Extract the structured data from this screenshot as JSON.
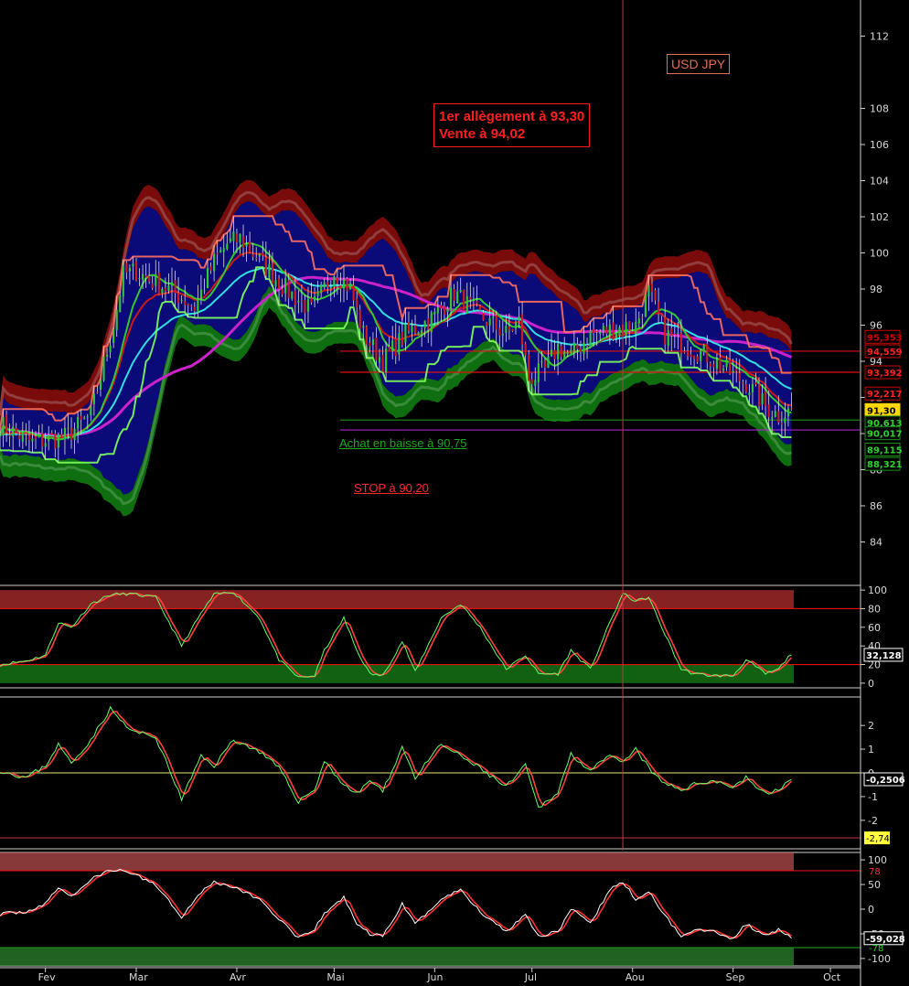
{
  "symbol_label": "USD JPY",
  "trade_note": {
    "line1": "1er allègement à 93,30",
    "line2": "Vente à 94,02"
  },
  "buy_note": "Achat en baisse à 90,75",
  "stop_note": "STOP à 90,20",
  "colors": {
    "background": "#000000",
    "band_fill": "#0a0a78",
    "upper_band": "#7a0b0b",
    "lower_band": "#0f6e0f",
    "cyan_ma": "#33dede",
    "magenta_ma": "#cc22cc",
    "red_ma": "#d01818",
    "green_ma": "#33c833",
    "salmon_stop": "#ff7060",
    "lime_stop": "#80ff60",
    "candle_up": "#33c833",
    "candle_down": "#cc1f1f"
  },
  "chart_data": [
    {
      "type": "candlestick",
      "title": "USD JPY",
      "x_tick_labels": [
        "Fev",
        "Mar",
        "Avr",
        "Mai",
        "Jun",
        "Jul",
        "Aou",
        "Sep",
        "Oct"
      ],
      "x_tick_days": [
        14,
        42,
        73,
        103,
        134,
        164,
        195,
        226,
        256
      ],
      "x_range_days": [
        0,
        265
      ],
      "ylim": [
        82,
        114
      ],
      "y_ticks": [
        84,
        86,
        88,
        90,
        92,
        94,
        96,
        98,
        100,
        102,
        104,
        106,
        108,
        112
      ],
      "price_keyframes": {
        "x": [
          0,
          10,
          20,
          28,
          35,
          38,
          42,
          46,
          52,
          60,
          66,
          70,
          74,
          80,
          88,
          96,
          103,
          108,
          112,
          118,
          125,
          134,
          140,
          148,
          156,
          160,
          163,
          168,
          172,
          176,
          182,
          190,
          196,
          200,
          205,
          212,
          218,
          224,
          230,
          236,
          240,
          244
        ],
        "y": [
          90.5,
          89.5,
          89.8,
          91.0,
          96.0,
          98.8,
          99.0,
          98.5,
          98.0,
          97.0,
          99.5,
          100.5,
          100.8,
          99.6,
          98.0,
          96.8,
          99.0,
          98.0,
          95.5,
          94.0,
          95.5,
          96.5,
          97.8,
          96.5,
          95.5,
          96.2,
          93.0,
          93.5,
          94.8,
          94.3,
          95.5,
          95.8,
          96.0,
          97.8,
          95.5,
          94.8,
          94.3,
          93.5,
          92.8,
          91.5,
          91.0,
          91.3
        ]
      },
      "horizontal_lines": [
        {
          "value": 94.559,
          "color": "#e01010"
        },
        {
          "value": 93.392,
          "color": "#e01010"
        },
        {
          "value": 90.75,
          "color": "#1b8f1b"
        },
        {
          "value": 90.2,
          "color": "#b020d0"
        }
      ],
      "vertical_marker_day": 192,
      "price_tags": [
        {
          "value": 95.353,
          "text": "95,353",
          "fg": "#cc0000",
          "bg": "#000000",
          "border": "#cc0000"
        },
        {
          "value": 94.559,
          "text": "94,559",
          "fg": "#ff2020",
          "bg": "#000000",
          "border": "#cc0000"
        },
        {
          "value": 93.392,
          "text": "93,392",
          "fg": "#ff2020",
          "bg": "#000000",
          "border": "#cc0000"
        },
        {
          "value": 92.217,
          "text": "92,217",
          "fg": "#ff2020",
          "bg": "#000000",
          "border": "#cc0000"
        },
        {
          "value": 91.3,
          "text": "91,30",
          "fg": "#000000",
          "bg": "#ffd700",
          "border": "#ffd700"
        },
        {
          "value": 90.613,
          "text": "90,613",
          "fg": "#33d033",
          "bg": "#000000",
          "border": "#1b8f1b"
        },
        {
          "value": 90.017,
          "text": "90,017",
          "fg": "#33d033",
          "bg": "#000000",
          "border": "#1b8f1b"
        },
        {
          "value": 89.115,
          "text": "89,115",
          "fg": "#33d033",
          "bg": "#000000",
          "border": "#1b8f1b"
        },
        {
          "value": 88.321,
          "text": "88,321",
          "fg": "#33d033",
          "bg": "#000000",
          "border": "#1b8f1b"
        }
      ]
    },
    {
      "type": "line",
      "name": "stochastic",
      "ylim": [
        -5,
        105
      ],
      "y_ticks": [
        100,
        80,
        60,
        40,
        20,
        0
      ],
      "y_tick_texts": [
        "100",
        "80",
        "60",
        "40",
        "20",
        "0"
      ],
      "zones": [
        {
          "from": 80,
          "to": 100,
          "color": "#c03030"
        },
        {
          "from": 0,
          "to": 20,
          "color": "#1a8a1a"
        }
      ],
      "levels": [
        80,
        20
      ],
      "keyframes": {
        "x": [
          0,
          8,
          14,
          18,
          22,
          28,
          34,
          40,
          48,
          56,
          62,
          66,
          72,
          80,
          86,
          92,
          97,
          100,
          106,
          110,
          114,
          118,
          124,
          128,
          136,
          142,
          148,
          156,
          162,
          166,
          172,
          176,
          182,
          188,
          192,
          196,
          200,
          204,
          210,
          214,
          220,
          226,
          230,
          236,
          240,
          244
        ],
        "y": [
          20,
          24,
          30,
          65,
          60,
          85,
          95,
          96,
          92,
          40,
          75,
          95,
          98,
          70,
          25,
          6,
          8,
          35,
          70,
          35,
          10,
          8,
          45,
          12,
          70,
          85,
          60,
          15,
          30,
          10,
          10,
          35,
          15,
          65,
          96,
          88,
          92,
          60,
          15,
          10,
          8,
          8,
          25,
          10,
          15,
          32
        ]
      },
      "last_value_text": "32,128"
    },
    {
      "type": "line",
      "name": "momentum",
      "ylim": [
        -3.2,
        3.2
      ],
      "y_ticks": [
        2,
        1,
        0,
        -1,
        -2
      ],
      "y_tick_texts": [
        "2",
        "1",
        "0",
        "-1",
        "-2"
      ],
      "levels": [
        0,
        -2.74
      ],
      "keyframes": {
        "x": [
          0,
          8,
          14,
          18,
          22,
          28,
          34,
          40,
          48,
          56,
          62,
          66,
          72,
          80,
          86,
          92,
          97,
          100,
          106,
          110,
          114,
          118,
          124,
          128,
          136,
          142,
          148,
          156,
          162,
          166,
          172,
          176,
          182,
          188,
          192,
          196,
          200,
          204,
          210,
          214,
          220,
          226,
          230,
          236,
          240,
          244
        ],
        "y": [
          0.1,
          -0.2,
          0.3,
          1.2,
          0.4,
          1.4,
          2.7,
          1.8,
          1.5,
          -1.1,
          0.7,
          0.3,
          1.4,
          0.9,
          0.2,
          -1.2,
          -0.7,
          0.5,
          -0.5,
          -0.9,
          -0.3,
          -0.8,
          1.1,
          -0.2,
          1.2,
          0.7,
          0.2,
          -0.6,
          0.3,
          -1.5,
          -0.8,
          0.8,
          0.1,
          0.7,
          0.4,
          1.0,
          0.2,
          -0.4,
          -0.7,
          -0.5,
          -0.3,
          -0.6,
          -0.2,
          -0.9,
          -0.7,
          -0.25
        ]
      },
      "last_value_text": "-0,2506",
      "marker_text": "-2,74"
    },
    {
      "type": "line",
      "name": "williams",
      "ylim": [
        -115,
        115
      ],
      "y_ticks": [
        100,
        50,
        0,
        -50,
        -100
      ],
      "y_tick_texts": [
        "100",
        "50",
        "0",
        "-50",
        "-100"
      ],
      "zones": [
        {
          "from": 78,
          "to": 115,
          "color": "#c05050"
        },
        {
          "from": -115,
          "to": -78,
          "color": "#2f8a2f"
        }
      ],
      "levels": [
        78,
        -78
      ],
      "keyframes": {
        "x": [
          0,
          8,
          14,
          18,
          22,
          28,
          34,
          40,
          48,
          56,
          62,
          66,
          72,
          80,
          86,
          92,
          97,
          100,
          106,
          110,
          114,
          118,
          124,
          128,
          136,
          142,
          148,
          156,
          162,
          166,
          172,
          176,
          182,
          188,
          192,
          196,
          200,
          204,
          210,
          214,
          220,
          226,
          230,
          236,
          240,
          244
        ],
        "y": [
          -10,
          -5,
          10,
          45,
          25,
          60,
          80,
          75,
          50,
          -15,
          35,
          55,
          45,
          20,
          -20,
          -60,
          -40,
          -10,
          25,
          -30,
          -50,
          -55,
          10,
          -30,
          20,
          40,
          -5,
          -45,
          -10,
          -55,
          -45,
          0,
          -30,
          40,
          55,
          20,
          35,
          -5,
          -55,
          -40,
          -45,
          -60,
          -30,
          -55,
          -40,
          -59
        ]
      },
      "last_value_text": "-59,028",
      "level_tag_texts": [
        "78",
        "-78"
      ]
    }
  ]
}
